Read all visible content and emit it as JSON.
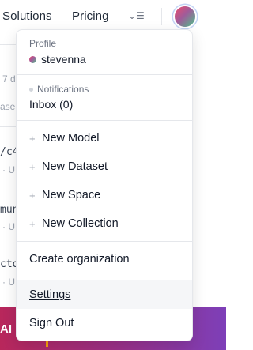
{
  "nav": {
    "solutions": "Solutions",
    "pricing": "Pricing",
    "more_icon": "chevron-down-menu-icon"
  },
  "background": {
    "fragment_1": "7 d",
    "fragment_2": "ase",
    "fragment_3": "/c4",
    "fragment_4": "U",
    "fragment_5": "mun",
    "fragment_6": "U",
    "fragment_7": "cto",
    "fragment_8": "U",
    "banner_text": "AI"
  },
  "menu": {
    "profile": {
      "label": "Profile",
      "username": "stevenna"
    },
    "notifications": {
      "label": "Notifications",
      "inbox": "Inbox (0)"
    },
    "create_items": [
      {
        "label": "New Model"
      },
      {
        "label": "New Dataset"
      },
      {
        "label": "New Space"
      },
      {
        "label": "New Collection"
      }
    ],
    "create_org": "Create organization",
    "settings": "Settings",
    "sign_out": "Sign Out"
  },
  "colors": {
    "avatar_gradient": [
      "#ef4b6b",
      "#a05b9a",
      "#4cc38a"
    ],
    "banner_gradient": [
      "#b8275b",
      "#7d3fb8"
    ],
    "hover_row": "#f5f6f8"
  }
}
